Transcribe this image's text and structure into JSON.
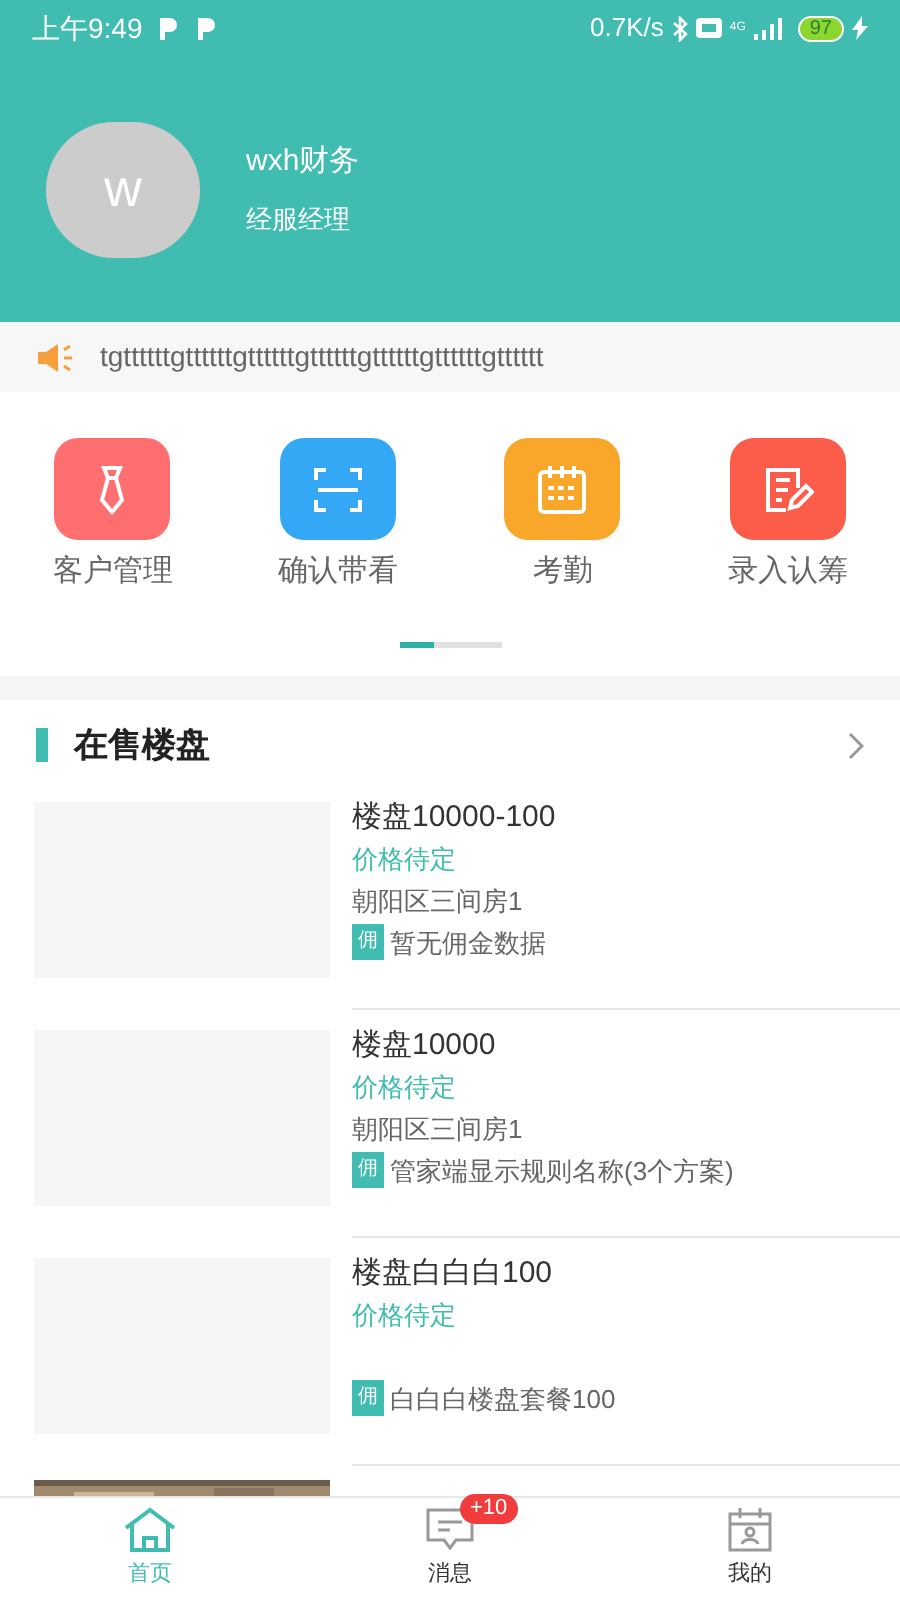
{
  "status_bar": {
    "time": "上午9:49",
    "speed": "0.7K/s",
    "network": "4G",
    "battery": "97"
  },
  "profile": {
    "avatar_letter": "w",
    "name": "wxh财务",
    "role": "经服经理"
  },
  "notice": {
    "text": "tgttttttgttttttgttttttgttttttgttttttgttttttgtttttt"
  },
  "quick_menu": [
    {
      "label": "客户管理",
      "kind": "tie",
      "color": "#ff6f6f"
    },
    {
      "label": "确认带看",
      "kind": "scan",
      "color": "#35a8f5"
    },
    {
      "label": "考勤",
      "kind": "calendar",
      "color": "#f9a72b"
    },
    {
      "label": "录入认筹",
      "kind": "edit",
      "color": "#fb5d4a"
    }
  ],
  "pager": [
    {
      "selected": true
    },
    {
      "selected": false
    },
    {
      "selected": false
    }
  ],
  "section": {
    "title": "在售楼盘"
  },
  "listings": [
    {
      "title": "楼盘10000-100",
      "price": "价格待定",
      "address": "朝阳区三间房1",
      "tag": "佣",
      "commission": "暂无佣金数据"
    },
    {
      "title": "楼盘10000",
      "price": "价格待定",
      "address": "朝阳区三间房1",
      "tag": "佣",
      "commission": "管家端显示规则名称(3个方案)"
    },
    {
      "title": "楼盘白白白100",
      "price": "价格待定",
      "tag": "佣",
      "commission": "白白白楼盘套餐100"
    }
  ],
  "bottom_nav": [
    {
      "label": "首页",
      "kind": "home",
      "selected": true
    },
    {
      "label": "消息",
      "kind": "message",
      "selected": false,
      "badge": "+10"
    },
    {
      "label": "我的",
      "kind": "profile",
      "selected": false
    }
  ]
}
